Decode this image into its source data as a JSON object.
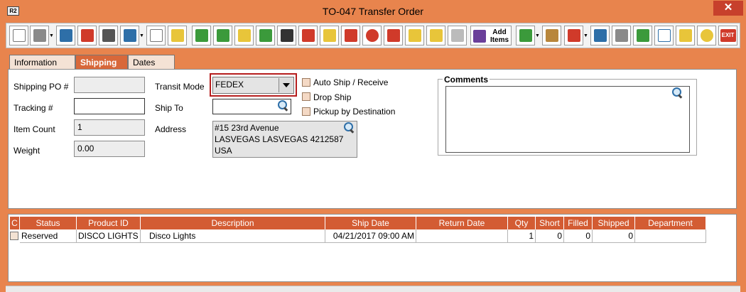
{
  "window": {
    "title": "TO-047 Transfer Order",
    "logo": "R2",
    "close": "✕"
  },
  "toolbar": {
    "add_items_label": "Add\nItems",
    "icons": [
      "new-icon",
      "print-icon",
      "save-icon",
      "delete-icon",
      "find-icon",
      "cut-icon",
      "copy-icon",
      "paste-icon",
      "add-row-icon",
      "insert-row-icon",
      "edit-icon",
      "refresh-icon",
      "cycle-icon",
      "asset-icon",
      "barcode-icon",
      "misc-po-icon",
      "no-icon",
      "cancel-doc-icon",
      "file-icon",
      "schedule-icon",
      "eraser-icon",
      "add-items-icon",
      "receive-icon",
      "pack-icon",
      "ship-icon",
      "truck-icon",
      "print-label-icon",
      "terminal-icon",
      "report-icon",
      "warning-icon",
      "clock-icon",
      "exit-icon"
    ],
    "exit_label": "EXIT",
    "colors": {
      "red": "#D03A2A",
      "blue": "#2E6FA8",
      "green": "#3B9A3B",
      "yellow": "#E8C53A",
      "purple": "#6A3F9A",
      "gray": "#8A8A8A",
      "orange": "#E8844D"
    }
  },
  "tabs": [
    {
      "label": "Information",
      "active": false
    },
    {
      "label": "Shipping",
      "active": true
    },
    {
      "label": "Dates",
      "active": false
    }
  ],
  "form": {
    "shipping_po_label": "Shipping PO #",
    "shipping_po_value": "",
    "tracking_label": "Tracking #",
    "tracking_value": "",
    "item_count_label": "Item Count",
    "item_count_value": "1",
    "weight_label": "Weight",
    "weight_value": "0.00",
    "transit_mode_label": "Transit Mode",
    "transit_mode_value": "FEDEX",
    "ship_to_label": "Ship To",
    "ship_to_value": "",
    "address_label": "Address",
    "address_lines": [
      "#15 23rd Avenue",
      "LASVEGAS LASVEGAS 4212587",
      "USA"
    ],
    "auto_ship_label": "Auto Ship / Receive",
    "drop_ship_label": "Drop Ship",
    "pickup_label": "Pickup by Destination",
    "comments_label": "Comments"
  },
  "grid": {
    "columns": [
      "C",
      "Status",
      "Product ID",
      "Description",
      "Ship Date",
      "Return Date",
      "Qty",
      "Short",
      "Filled",
      "Shipped",
      "Department"
    ],
    "rows": [
      {
        "status": "Reserved",
        "product_id": "DISCO LIGHTS",
        "description": "Disco Lights",
        "ship_date": "04/21/2017 09:00 AM",
        "return_date": "",
        "qty": "1",
        "short": "0",
        "filled": "0",
        "shipped": "0",
        "department": ""
      }
    ]
  }
}
